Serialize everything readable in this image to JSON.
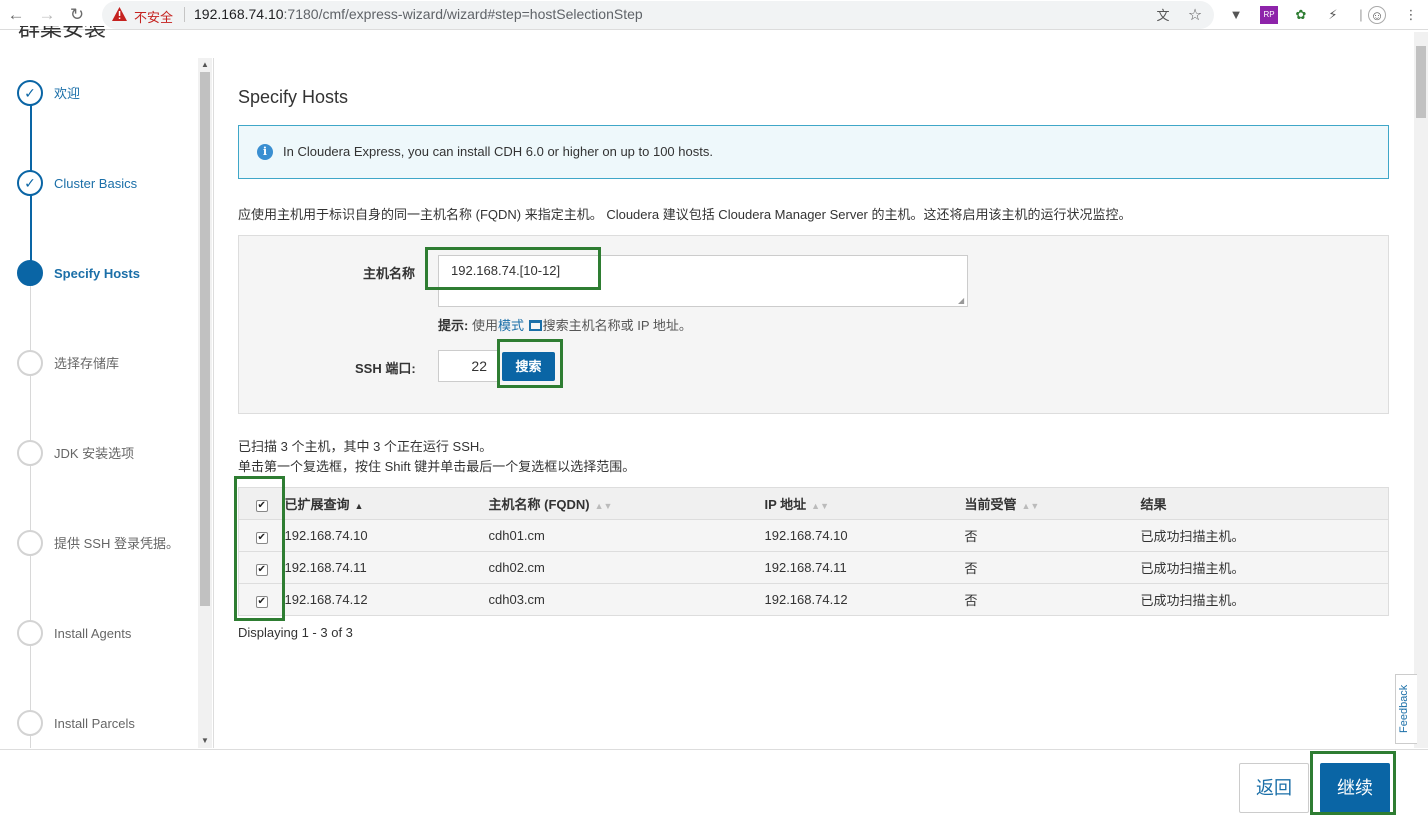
{
  "browser": {
    "insecure_label": "不安全",
    "url_host": "192.168.74.10",
    "url_rest": ":7180/cmf/express-wizard/wizard#step=hostSelectionStep"
  },
  "page": {
    "title": "群集安装"
  },
  "steps": [
    {
      "label": "欢迎",
      "state": "done"
    },
    {
      "label": "Cluster Basics",
      "state": "done"
    },
    {
      "label": "Specify Hosts",
      "state": "active"
    },
    {
      "label": "选择存储库",
      "state": "pending"
    },
    {
      "label": "JDK 安装选项",
      "state": "pending"
    },
    {
      "label": "提供 SSH 登录凭据。",
      "state": "pending"
    },
    {
      "label": "Install Agents",
      "state": "pending"
    },
    {
      "label": "Install Parcels",
      "state": "pending"
    }
  ],
  "main": {
    "heading": "Specify Hosts",
    "info": "In Cloudera Express, you can install CDH 6.0 or higher on up to 100 hosts.",
    "description": "应使用主机用于标识自身的同一主机名称 (FQDN) 来指定主机。 Cloudera 建议包括 Cloudera Manager Server 的主机。这还将启用该主机的运行状况监控。",
    "hostname_label": "主机名称",
    "hostname_value": "192.168.74.[10-12]",
    "hint_prefix": "提示:",
    "hint_use": "使用",
    "hint_link": "模式",
    "hint_rest": "搜索主机名称或 IP 地址。",
    "ssh_label": "SSH 端口:",
    "ssh_value": "22",
    "search_button": "搜索",
    "scan_summary": "已扫描 3 个主机，其中 3 个正在运行 SSH。",
    "scan_tip": "单击第一个复选框，按住 Shift 键并单击最后一个复选框以选择范围。",
    "displaying": "Displaying 1 - 3 of 3"
  },
  "table": {
    "headers": [
      "已扩展查询",
      "主机名称 (FQDN)",
      "IP 地址",
      "当前受管",
      "结果"
    ],
    "rows": [
      {
        "query": "192.168.74.10",
        "fqdn": "cdh01.cm",
        "ip": "192.168.74.10",
        "managed": "否",
        "result": "已成功扫描主机。",
        "checked": true
      },
      {
        "query": "192.168.74.11",
        "fqdn": "cdh02.cm",
        "ip": "192.168.74.11",
        "managed": "否",
        "result": "已成功扫描主机。",
        "checked": true
      },
      {
        "query": "192.168.74.12",
        "fqdn": "cdh03.cm",
        "ip": "192.168.74.12",
        "managed": "否",
        "result": "已成功扫描主机。",
        "checked": true
      }
    ]
  },
  "feedback": "Feedback",
  "footer": {
    "back": "返回",
    "next": "继续"
  },
  "colors": {
    "accent": "#0a65a5",
    "highlight": "#2e7d32",
    "info_border": "#3fa7c8"
  }
}
